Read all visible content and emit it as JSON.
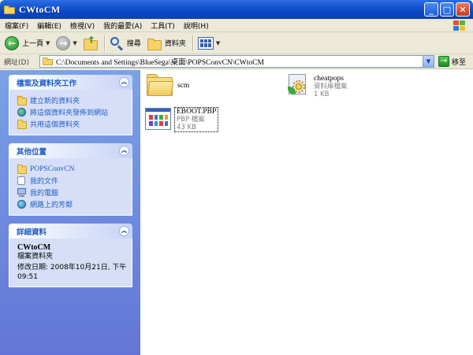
{
  "window": {
    "title": "CWtoCM"
  },
  "menu": [
    "檔案(F)",
    "編輯(E)",
    "檢視(V)",
    "我的最愛(A)",
    "工具(T)",
    "說明(H)"
  ],
  "toolbar": {
    "back_label": "上一頁",
    "search_label": "搜尋",
    "folders_label": "資料夾"
  },
  "address": {
    "label": "網址(D)",
    "path": "C:\\Documents and Settings\\BlueSega\\桌面\\POPSConvCN\\CWtoCM",
    "go_label": "移至"
  },
  "tasks_panel": {
    "title": "檔案及資料夾工作",
    "items": [
      {
        "label": "建立新的資料夾",
        "icon": "new-folder-icon"
      },
      {
        "label": "將這個資料夾發佈到網站",
        "icon": "publish-web-icon"
      },
      {
        "label": "共用這個資料夾",
        "icon": "share-folder-icon"
      }
    ]
  },
  "places_panel": {
    "title": "其他位置",
    "items": [
      {
        "label": "POPSConvCN",
        "icon": "folder-icon"
      },
      {
        "label": "我的文件",
        "icon": "my-documents-icon"
      },
      {
        "label": "我的電腦",
        "icon": "my-computer-icon"
      },
      {
        "label": "網路上的芳鄰",
        "icon": "network-places-icon"
      }
    ]
  },
  "details_panel": {
    "title": "詳細資料",
    "name": "CWtoCM",
    "type": "檔案資料夾",
    "modified": "修改日期: 2008年10月21日, 下午 09:51"
  },
  "files": [
    {
      "name": "scm",
      "icon": "folder-icon"
    },
    {
      "name": "cheatpops",
      "type": "資料庫檔案",
      "size": "1 KB",
      "icon": "setup-file-icon"
    },
    {
      "name": "EBOOT.PBP",
      "type": "PBP 檔案",
      "size": "43 KB",
      "icon": "pbp-file-icon"
    }
  ]
}
